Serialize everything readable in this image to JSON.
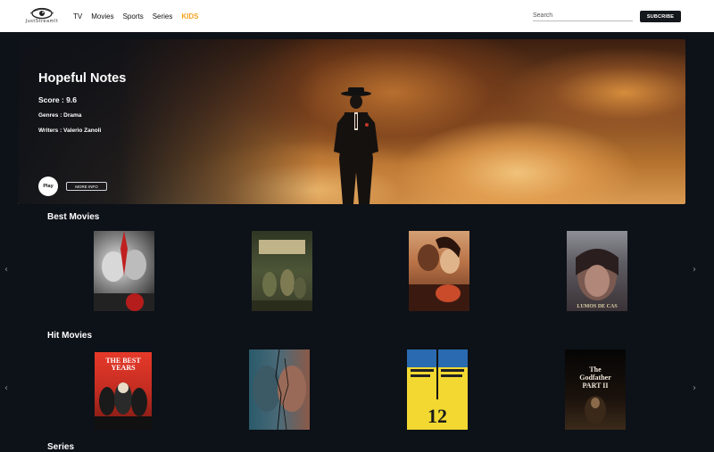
{
  "header": {
    "logo_text": "JustStreamIt",
    "nav": [
      "TV",
      "Movies",
      "Sports",
      "Series",
      "KIDS"
    ],
    "search_placeholder": "Search",
    "subscribe_label": "SUBCRIBE"
  },
  "hero": {
    "title": "Hopeful Notes",
    "score": "Score : 9.6",
    "genres": "Genres : Drama",
    "writers": "Writers : Valerio Zanoli",
    "play_label": "Play",
    "more_info_label": "MORE INFO"
  },
  "rows": {
    "best_movies": {
      "title": "Best Movies",
      "posters": [
        {
          "text": ""
        },
        {
          "text": ""
        },
        {
          "text": ""
        },
        {
          "text": "LUMOS DE CAS"
        }
      ]
    },
    "hit_movies": {
      "title": "Hit Movies",
      "posters": [
        {
          "text": "THE BEST YEARS"
        },
        {
          "text": ""
        },
        {
          "text": "12"
        },
        {
          "text": "The Godfather PART II"
        }
      ]
    },
    "series": {
      "title": "Series"
    }
  },
  "colors": {
    "background": "#0d1118",
    "kids_accent": "#f4a31e",
    "header_bg": "#ffffff"
  },
  "icons": {
    "prev": "chevron-left-icon",
    "next": "chevron-right-icon"
  }
}
